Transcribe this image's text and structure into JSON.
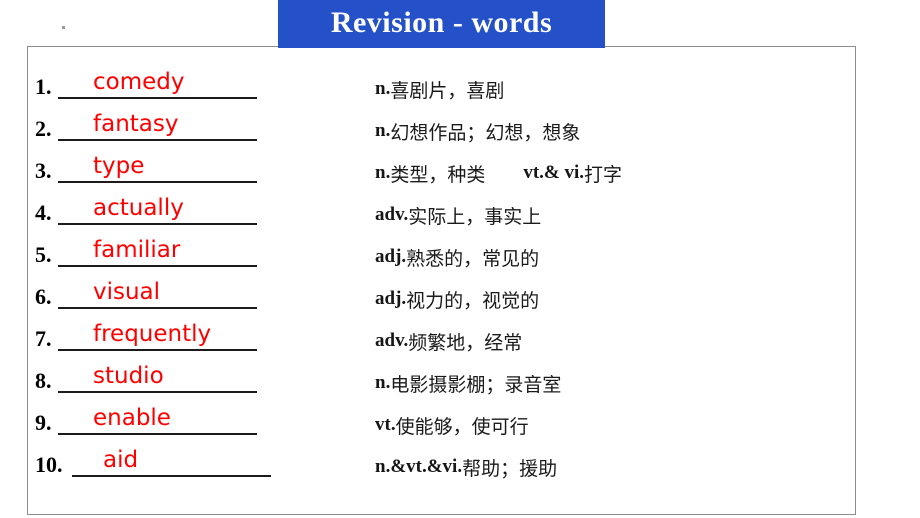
{
  "slide": {
    "title": "Revision - words",
    "banner_color": "#2450c8",
    "answer_color": "#ff0000",
    "frame_border_color": "#8d8d8d"
  },
  "items": [
    {
      "number": "1.",
      "answer": "comedy",
      "pos": "n.",
      "meaning": "喜剧片，喜剧",
      "pos2": "",
      "meaning2": ""
    },
    {
      "number": "2.",
      "answer": "fantasy",
      "pos": "n.",
      "meaning": "幻想作品；幻想，想象",
      "pos2": "",
      "meaning2": ""
    },
    {
      "number": "3.",
      "answer": "type",
      "pos": "n.",
      "meaning": "类型，种类",
      "pos2": "vt.& vi.",
      "meaning2": "打字"
    },
    {
      "number": "4.",
      "answer": "actually",
      "pos": "adv.",
      "meaning": "实际上，事实上",
      "pos2": "",
      "meaning2": ""
    },
    {
      "number": "5.",
      "answer": "familiar",
      "pos": "adj.",
      "meaning": "熟悉的，常见的",
      "pos2": "",
      "meaning2": ""
    },
    {
      "number": "6.",
      "answer": "visual",
      "pos": "adj.",
      "meaning": "视力的，视觉的",
      "pos2": "",
      "meaning2": ""
    },
    {
      "number": "7.",
      "answer": "frequently",
      "pos": "adv.",
      "meaning": "频繁地，经常",
      "pos2": "",
      "meaning2": ""
    },
    {
      "number": "8.",
      "answer": "studio",
      "pos": "n.",
      "meaning": "电影摄影棚；录音室",
      "pos2": "",
      "meaning2": ""
    },
    {
      "number": "9.",
      "answer": "enable",
      "pos": "vt.",
      "meaning": "使能够，使可行",
      "pos2": "",
      "meaning2": ""
    },
    {
      "number": "10.",
      "answer": "aid",
      "pos": "n.&vt.&vi.",
      "meaning": "帮助；援助",
      "pos2": "",
      "meaning2": ""
    }
  ]
}
